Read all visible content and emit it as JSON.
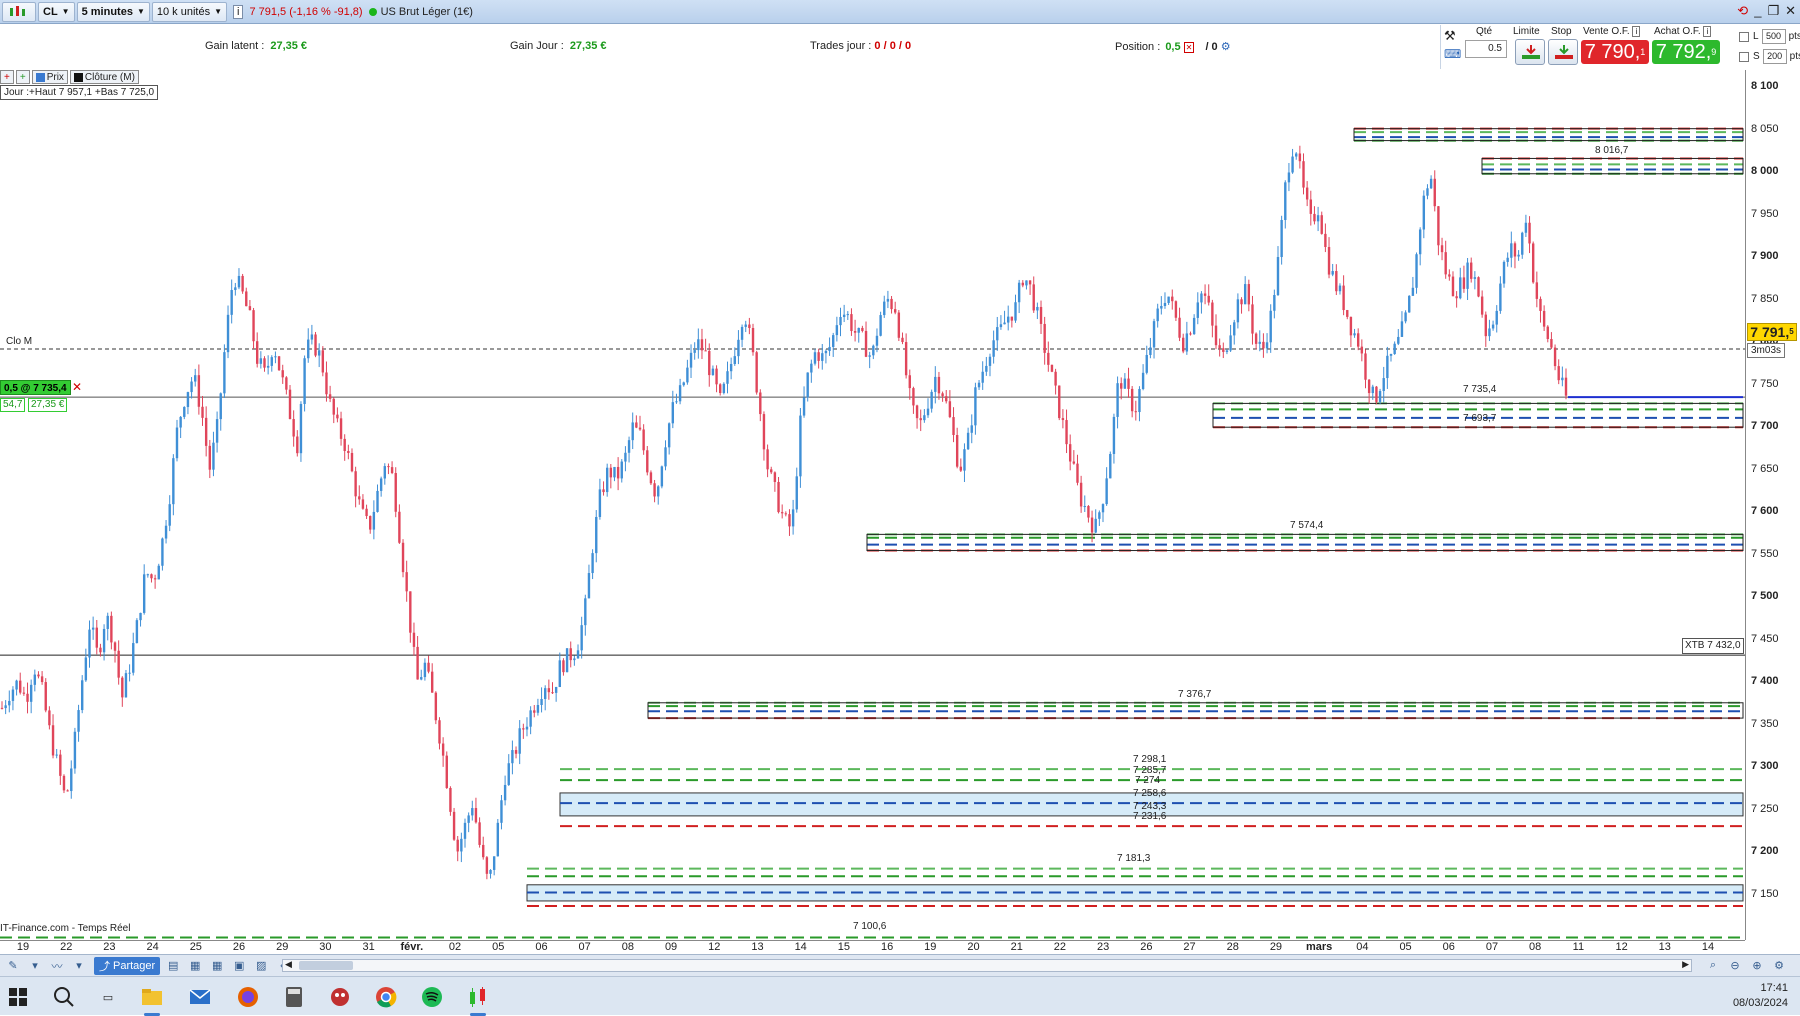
{
  "toolbar": {
    "symbol": "CL",
    "interval": "5 minutes",
    "units": "10 k unités",
    "price_change": "7 791,5 (-1,16 % -91,8)",
    "instrument": "US Brut Léger (1€)"
  },
  "info": {
    "gain_latent_label": "Gain latent :",
    "gain_latent_value": "27,35 €",
    "gain_jour_label": "Gain Jour :",
    "gain_jour_value": "27,35 €",
    "trades_label": "Trades jour :",
    "trades_value": "0 / 0 / 0",
    "position_label": "Position :",
    "position_value": "0,5",
    "position_extra": "/ 0"
  },
  "trade_panel": {
    "qty_label": "Qté",
    "qty_value": "0.5",
    "limit_label": "Limite",
    "stop_label": "Stop",
    "sell_label": "Vente O.F.",
    "buy_label": "Achat O.F.",
    "sell_price": "7 790,",
    "sell_price_sup": "1",
    "buy_price": "7 792,",
    "buy_price_sup": "9",
    "l_label": "L",
    "l_pts": "500",
    "s_label": "S",
    "s_pts": "200",
    "pts_label": "pts",
    "sell_color": "#e0262b",
    "buy_color": "#2db92d"
  },
  "chart": {
    "legend": {
      "prix": "Prix",
      "cloture": "Clôture (M)"
    },
    "day_range": "Jour :+Haut 7 957,1 +Bas 7 725,0",
    "clo_label": "Clo M",
    "position_tag": "0,5 @ 7 735,4",
    "position_sub1": "54,7",
    "position_sub2": "27,35 €",
    "current_price": "7 791,",
    "current_price_sup": "5",
    "timer": "3m03s",
    "xtb_tag": "XTB 7 432,0",
    "source": "IT-Finance.com - Temps Réel",
    "level_labels": {
      "l7298": "7 298,1",
      "l7285": "7 285,7",
      "l7274": "7 274",
      "l7258": "7 258,6",
      "l7243": "7 243,3",
      "l7231": "7 231,6",
      "l7181": "7 181,3",
      "l7100": "7 100,6",
      "l7735": "7 735,4",
      "l7693": "7 693,7",
      "l7574": "7 574,4",
      "l7376": "7 376,7",
      "l8016": "8 016,7"
    }
  },
  "chart_data": {
    "type": "candlestick",
    "instrument": "US Brut Léger (1€)",
    "interval": "5 minutes",
    "ylim": [
      7085,
      8130
    ],
    "y_ticks": [
      8100,
      8050,
      8000,
      7950,
      7900,
      7850,
      7800,
      7750,
      7700,
      7650,
      7600,
      7550,
      7500,
      7450,
      7400,
      7350,
      7300,
      7250,
      7200,
      7150
    ],
    "y_tick_labels": [
      "8 100",
      "8 050",
      "8 000",
      "7 950",
      "7 900",
      "7 850",
      "7 800",
      "7 750",
      "7 700",
      "7 650",
      "7 600",
      "7 550",
      "7 500",
      "7 450",
      "7 400",
      "7 350",
      "7 300",
      "7 250",
      "7 200",
      "7 150"
    ],
    "x_ticks": [
      "19",
      "22",
      "23",
      "24",
      "25",
      "26",
      "29",
      "30",
      "31",
      "févr.",
      "02",
      "05",
      "06",
      "07",
      "08",
      "09",
      "12",
      "13",
      "14",
      "15",
      "16",
      "19",
      "20",
      "21",
      "22",
      "23",
      "26",
      "27",
      "28",
      "29",
      "mars",
      "04",
      "05",
      "06",
      "07",
      "08",
      "11",
      "12",
      "13",
      "14"
    ],
    "current_price": 7791.5,
    "close_m": 7792,
    "position_entry": 7735.4,
    "xtb_level": 7432.0,
    "path_points": [
      7370,
      7390,
      7400,
      7380,
      7420,
      7390,
      7340,
      7300,
      7260,
      7320,
      7400,
      7470,
      7430,
      7480,
      7450,
      7380,
      7420,
      7470,
      7530,
      7520,
      7560,
      7620,
      7700,
      7740,
      7760,
      7720,
      7650,
      7700,
      7800,
      7880,
      7860,
      7830,
      7780,
      7760,
      7800,
      7760,
      7720,
      7680,
      7790,
      7800,
      7780,
      7730,
      7700,
      7680,
      7640,
      7600,
      7580,
      7620,
      7660,
      7640,
      7560,
      7480,
      7400,
      7420,
      7380,
      7330,
      7270,
      7200,
      7230,
      7260,
      7200,
      7160,
      7220,
      7290,
      7310,
      7340,
      7360,
      7380,
      7400,
      7390,
      7420,
      7430,
      7440,
      7480,
      7560,
      7620,
      7650,
      7640,
      7660,
      7700,
      7690,
      7650,
      7620,
      7680,
      7720,
      7740,
      7770,
      7800,
      7790,
      7760,
      7730,
      7760,
      7800,
      7840,
      7790,
      7720,
      7650,
      7620,
      7590,
      7580,
      7700,
      7760,
      7790,
      7780,
      7800,
      7840,
      7830,
      7810,
      7800,
      7780,
      7830,
      7850,
      7840,
      7780,
      7720,
      7700,
      7730,
      7760,
      7740,
      7700,
      7650,
      7680,
      7740,
      7770,
      7800,
      7810,
      7830,
      7840,
      7880,
      7860,
      7820,
      7780,
      7740,
      7700,
      7660,
      7620,
      7600,
      7580,
      7620,
      7680,
      7760,
      7740,
      7720,
      7760,
      7800,
      7840,
      7860,
      7830,
      7800,
      7820,
      7860,
      7850,
      7800,
      7780,
      7820,
      7850,
      7860,
      7800,
      7790,
      7830,
      7900,
      8000,
      8040,
      7980,
      7940,
      7960,
      7900,
      7870,
      7850,
      7820,
      7800,
      7760,
      7730,
      7760,
      7780,
      7800,
      7830,
      7880,
      7960,
      8000,
      7920,
      7880,
      7860,
      7870,
      7890,
      7860,
      7810,
      7830,
      7880,
      7910,
      7900,
      7950,
      7870,
      7820,
      7800,
      7760,
      7735
    ]
  },
  "bottom_tools": {
    "share_label": "Partager"
  },
  "taskbar": {
    "time": "17:41",
    "date": "08/03/2024"
  }
}
